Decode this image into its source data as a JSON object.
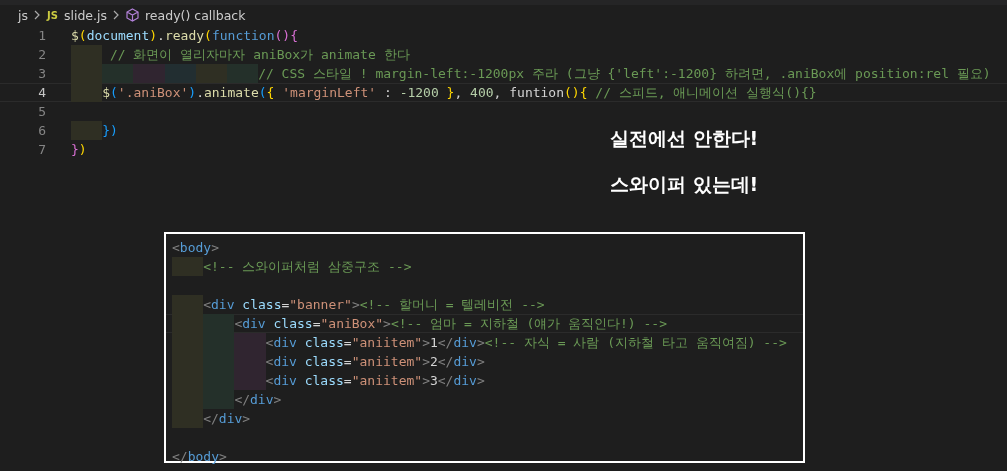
{
  "breadcrumb": [
    {
      "kind": "folder",
      "label": "js"
    },
    {
      "kind": "file",
      "badge": "JS",
      "label": "slide.js"
    },
    {
      "kind": "symbol",
      "label": "ready() callback"
    }
  ],
  "editor": {
    "lines": [
      {
        "number": "1",
        "current": false,
        "tokens": [
          {
            "t": "$",
            "kind": "fn"
          },
          {
            "t": "(",
            "kind": "b1"
          },
          {
            "t": "document",
            "kind": "ident"
          },
          {
            "t": ")",
            "kind": "b1"
          },
          {
            "t": ".",
            "kind": "text"
          },
          {
            "t": "ready",
            "kind": "fn"
          },
          {
            "t": "(",
            "kind": "b1"
          },
          {
            "t": "function",
            "kind": "keyword"
          },
          {
            "t": "()",
            "kind": "b2"
          },
          {
            "t": "{",
            "kind": "b2"
          }
        ]
      },
      {
        "number": "2",
        "current": false,
        "tokens": [
          {
            "t": "     // 화면이 열리자마자 aniBox가 animate 한다",
            "kind": "comment"
          }
        ]
      },
      {
        "number": "3",
        "current": false,
        "tokens": [
          {
            "t": "                        // CSS 스타일 ! margin-left:-1200px 주라 (그냥 {'left':-1200} 하려면, .aniBox에 position:rel 필요)",
            "kind": "comment"
          }
        ]
      },
      {
        "number": "4",
        "current": true,
        "tokens": [
          {
            "t": "    $",
            "kind": "fn"
          },
          {
            "t": "(",
            "kind": "b3"
          },
          {
            "t": "'.aniBox'",
            "kind": "string"
          },
          {
            "t": ")",
            "kind": "b3"
          },
          {
            "t": ".",
            "kind": "text"
          },
          {
            "t": "animate",
            "kind": "fn"
          },
          {
            "t": "(",
            "kind": "b3"
          },
          {
            "t": "{",
            "kind": "b1"
          },
          {
            "t": " 'marginLeft'",
            "kind": "string"
          },
          {
            "t": " : ",
            "kind": "text"
          },
          {
            "t": "-1200",
            "kind": "number"
          },
          {
            "t": " }",
            "kind": "b1"
          },
          {
            "t": ", ",
            "kind": "text"
          },
          {
            "t": "400",
            "kind": "number"
          },
          {
            "t": ", ",
            "kind": "text"
          },
          {
            "t": "funtion",
            "kind": "text"
          },
          {
            "t": "()",
            "kind": "b1"
          },
          {
            "t": "{",
            "kind": "b1"
          },
          {
            "t": " // 스피드, 애니메이션 실행식(){}",
            "kind": "comment"
          }
        ]
      },
      {
        "number": "5",
        "current": false
      },
      {
        "number": "6",
        "current": false,
        "tokens": [
          {
            "t": "    }",
            "kind": "b3"
          },
          {
            "t": ")",
            "kind": "b3"
          }
        ]
      },
      {
        "number": "7",
        "current": false,
        "tokens": [
          {
            "t": "}",
            "kind": "b2"
          },
          {
            "t": ")",
            "kind": "b1"
          }
        ]
      }
    ]
  },
  "notes": [
    "실전에선 안한다!",
    "스와이퍼 있는데!"
  ],
  "snippet": {
    "lines": [
      {
        "current": false,
        "tokens": [
          {
            "t": "<",
            "kind": "punct"
          },
          {
            "t": "body",
            "kind": "tag"
          },
          {
            "t": ">",
            "kind": "punct"
          }
        ]
      },
      {
        "current": false,
        "tokens": [
          {
            "t": "    <!-- 스와이퍼처럼 삼중구조 -->",
            "kind": "comment"
          }
        ]
      },
      {
        "current": false
      },
      {
        "current": false,
        "tokens": [
          {
            "t": "    <",
            "kind": "punct"
          },
          {
            "t": "div",
            "kind": "tag"
          },
          {
            "t": " class",
            "kind": "ident"
          },
          {
            "t": "=",
            "kind": "text"
          },
          {
            "t": "\"banner\"",
            "kind": "string"
          },
          {
            "t": ">",
            "kind": "punct"
          },
          {
            "t": "<!-- 할머니 = 텔레비전 -->",
            "kind": "comment"
          }
        ]
      },
      {
        "current": true,
        "tokens": [
          {
            "t": "        <",
            "kind": "punct"
          },
          {
            "t": "div",
            "kind": "tag"
          },
          {
            "t": " class",
            "kind": "ident"
          },
          {
            "t": "=",
            "kind": "text"
          },
          {
            "t": "\"aniBox\"",
            "kind": "string"
          },
          {
            "t": ">",
            "kind": "punct"
          },
          {
            "t": "<!-- 엄마 = 지하철 (얘가 움직인다!) -->",
            "kind": "comment"
          }
        ]
      },
      {
        "current": false,
        "tokens": [
          {
            "t": "            <",
            "kind": "punct"
          },
          {
            "t": "div",
            "kind": "tag"
          },
          {
            "t": " class",
            "kind": "ident"
          },
          {
            "t": "=",
            "kind": "text"
          },
          {
            "t": "\"aniitem\"",
            "kind": "string"
          },
          {
            "t": ">",
            "kind": "punct"
          },
          {
            "t": "1",
            "kind": "text"
          },
          {
            "t": "</",
            "kind": "punct"
          },
          {
            "t": "div",
            "kind": "tag"
          },
          {
            "t": ">",
            "kind": "punct"
          },
          {
            "t": "<!-- 자식 = 사람 (지하철 타고 움직여짐) -->",
            "kind": "comment"
          }
        ]
      },
      {
        "current": false,
        "tokens": [
          {
            "t": "            <",
            "kind": "punct"
          },
          {
            "t": "div",
            "kind": "tag"
          },
          {
            "t": " class",
            "kind": "ident"
          },
          {
            "t": "=",
            "kind": "text"
          },
          {
            "t": "\"aniitem\"",
            "kind": "string"
          },
          {
            "t": ">",
            "kind": "punct"
          },
          {
            "t": "2",
            "kind": "text"
          },
          {
            "t": "</",
            "kind": "punct"
          },
          {
            "t": "div",
            "kind": "tag"
          },
          {
            "t": ">",
            "kind": "punct"
          }
        ]
      },
      {
        "current": false,
        "tokens": [
          {
            "t": "            <",
            "kind": "punct"
          },
          {
            "t": "div",
            "kind": "tag"
          },
          {
            "t": " class",
            "kind": "ident"
          },
          {
            "t": "=",
            "kind": "text"
          },
          {
            "t": "\"aniitem\"",
            "kind": "string"
          },
          {
            "t": ">",
            "kind": "punct"
          },
          {
            "t": "3",
            "kind": "text"
          },
          {
            "t": "</",
            "kind": "punct"
          },
          {
            "t": "div",
            "kind": "tag"
          },
          {
            "t": ">",
            "kind": "punct"
          }
        ]
      },
      {
        "current": false,
        "tokens": [
          {
            "t": "        </",
            "kind": "punct"
          },
          {
            "t": "div",
            "kind": "tag"
          },
          {
            "t": ">",
            "kind": "punct"
          }
        ]
      },
      {
        "current": false,
        "tokens": [
          {
            "t": "    </",
            "kind": "punct"
          },
          {
            "t": "div",
            "kind": "tag"
          },
          {
            "t": ">",
            "kind": "punct"
          }
        ]
      },
      {
        "current": false
      },
      {
        "current": false,
        "tokens": [
          {
            "t": "</",
            "kind": "punct"
          },
          {
            "t": "body",
            "kind": "tag"
          },
          {
            "t": ">",
            "kind": "punct"
          }
        ]
      }
    ]
  }
}
